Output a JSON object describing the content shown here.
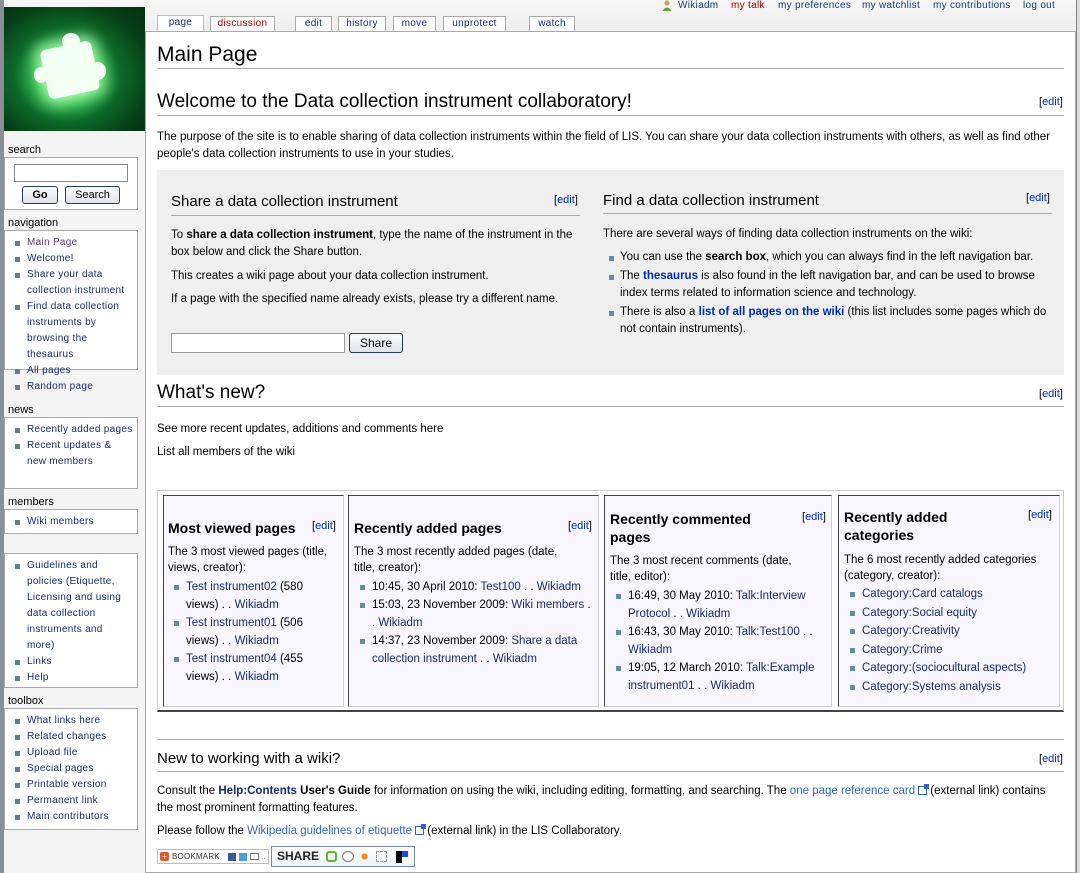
{
  "personal_tools": {
    "user": "Wikiadm",
    "my_talk": "my talk",
    "my_preferences": "my preferences",
    "my_watchlist": "my watchlist",
    "my_contributions": "my contributions",
    "log_out": "log out"
  },
  "tabs": [
    {
      "label": "page",
      "selected": true
    },
    {
      "label": "discussion",
      "new": true
    },
    {
      "label": "edit"
    },
    {
      "label": "history"
    },
    {
      "label": "move"
    },
    {
      "label": "unprotect"
    },
    {
      "label": "watch"
    }
  ],
  "sidebar": {
    "search": {
      "heading": "search",
      "value": "",
      "go_label": "Go",
      "search_label": "Search"
    },
    "navigation": {
      "heading": "navigation",
      "items": [
        "Main Page",
        "Welcome!",
        "Share your data collection instrument",
        "Find data collection instruments by browsing the thesaurus",
        "All pages",
        "Random page"
      ]
    },
    "news": {
      "heading": "news",
      "items": [
        "Recently added pages",
        "Recent updates & new members"
      ]
    },
    "members": {
      "heading": "members",
      "items": [
        "Wiki members"
      ]
    },
    "misc": {
      "heading": "",
      "items": [
        "Guidelines and policies (Etiquette, Licensing and using data collection instruments and more)",
        "Links",
        "Help"
      ]
    },
    "toolbox": {
      "heading": "toolbox",
      "items": [
        "What links here",
        "Related changes",
        "Upload file",
        "Special pages",
        "Printable version",
        "Permanent link",
        "Main contributors"
      ]
    }
  },
  "page": {
    "title": "Main Page",
    "edit_open": "[",
    "edit_label": "edit",
    "edit_close": "]",
    "welcome": {
      "heading": "Welcome to the Data collection instrument collaboratory!",
      "text": "The purpose of the site is to enable sharing of data collection instruments within the field of LIS. You can share your data collection instruments with others, as well as find other people's data collection instruments to use in your studies."
    },
    "share": {
      "heading": "Share a data collection instrument",
      "p1_pre": "To ",
      "p1_bold": "share a data collection instrument",
      "p1_post": ", type the name of the instrument in the box below and click the Share button.",
      "p2": "This creates a wiki page about your data collection instrument.",
      "p3": "If a page with the specified name already exists, please try a different name.",
      "input_value": "",
      "button_label": "Share"
    },
    "find": {
      "heading": "Find a data collection instrument",
      "intro": "There are several ways of finding data collection instruments on the wiki:",
      "items": [
        {
          "pre": "You can use the ",
          "bold": "search box",
          "post": ", which you can always find in the left navigation bar."
        },
        {
          "pre": "The ",
          "link": "thesaurus",
          "post": " is also found in the left navigation bar, and can be used to browse index terms related to information science and technology."
        },
        {
          "pre": "There is also a ",
          "link": "list of all pages on the wiki",
          "post": " (this list includes some pages which do not contain instruments)."
        }
      ]
    },
    "whats_new": {
      "heading": "What's new?",
      "link1": "See more recent updates, additions and comments here",
      "link2": "List all members of the wiki"
    },
    "boxes": {
      "most_viewed": {
        "title": "Most viewed pages",
        "desc": "The 3 most viewed pages (title, views, creator):",
        "items": [
          {
            "link": "Test instrument02",
            "views": " (580 views) . . ",
            "user": "Wikiadm"
          },
          {
            "link": "Test instrument01",
            "views": " (506 views) . . ",
            "user": "Wikiadm"
          },
          {
            "link": "Test instrument04",
            "views": " (455 views) . . ",
            "user": "Wikiadm"
          }
        ]
      },
      "recently_added": {
        "title": "Recently added pages",
        "desc": "The 3 most recently added pages (date, title, creator):",
        "items": [
          {
            "date": "10:45, 30 April 2010: ",
            "link": "Test100",
            "sep": " . . ",
            "user": "Wikiadm"
          },
          {
            "date": "15:03, 23 November 2009: ",
            "link": "Wiki members",
            "sep": " . . ",
            "user": "Wikiadm"
          },
          {
            "date": "14:37, 23 November 2009: ",
            "link": "Share a data collection instrument",
            "sep": " . . ",
            "user": "Wikiadm"
          }
        ]
      },
      "recently_commented": {
        "title": "Recently commented pages",
        "desc": "The 3 most recent comments (date, title, editor):",
        "items": [
          {
            "date": "16:49, 30 May 2010: ",
            "link": "Talk:Interview Protocol",
            "sep": " . . ",
            "user": "Wikiadm"
          },
          {
            "date": "16:43, 30 May 2010: ",
            "link": "Talk:Test100",
            "sep": " . . ",
            "user": "Wikiadm"
          },
          {
            "date": "19:05, 12 March 2010: ",
            "link": "Talk:Example instrument01",
            "sep": " . . ",
            "user": "Wikiadm"
          }
        ]
      },
      "recent_categories": {
        "title": "Recently added categories",
        "desc": "The 6 most recently added categories (category, creator):",
        "items": [
          "Category:Card catalogs",
          "Category:Social equity",
          "Category:Creativity",
          "Category:Crime",
          "Category:(sociocultural aspects)",
          "Category:Systems analysis"
        ]
      }
    },
    "new_to_wiki": {
      "heading": "New to working with a wiki?",
      "p1_pre": "Consult the ",
      "p1_link": "Help:Contents",
      "p1_bold": " User's Guide",
      "p1_mid": " for information on using the wiki, including editing, formatting, and searching. The ",
      "p1_ext": "one page reference card",
      "p1_post": " (external link) contains the most prominent formatting features.",
      "p2_pre": "Please follow the ",
      "p2_ext": "Wikipedia guidelines of etiquette",
      "p2_post": " (external link) in the LIS Collaboratory."
    },
    "social": {
      "bookmark_label": "BOOKMARK",
      "share_label": "SHARE"
    }
  }
}
